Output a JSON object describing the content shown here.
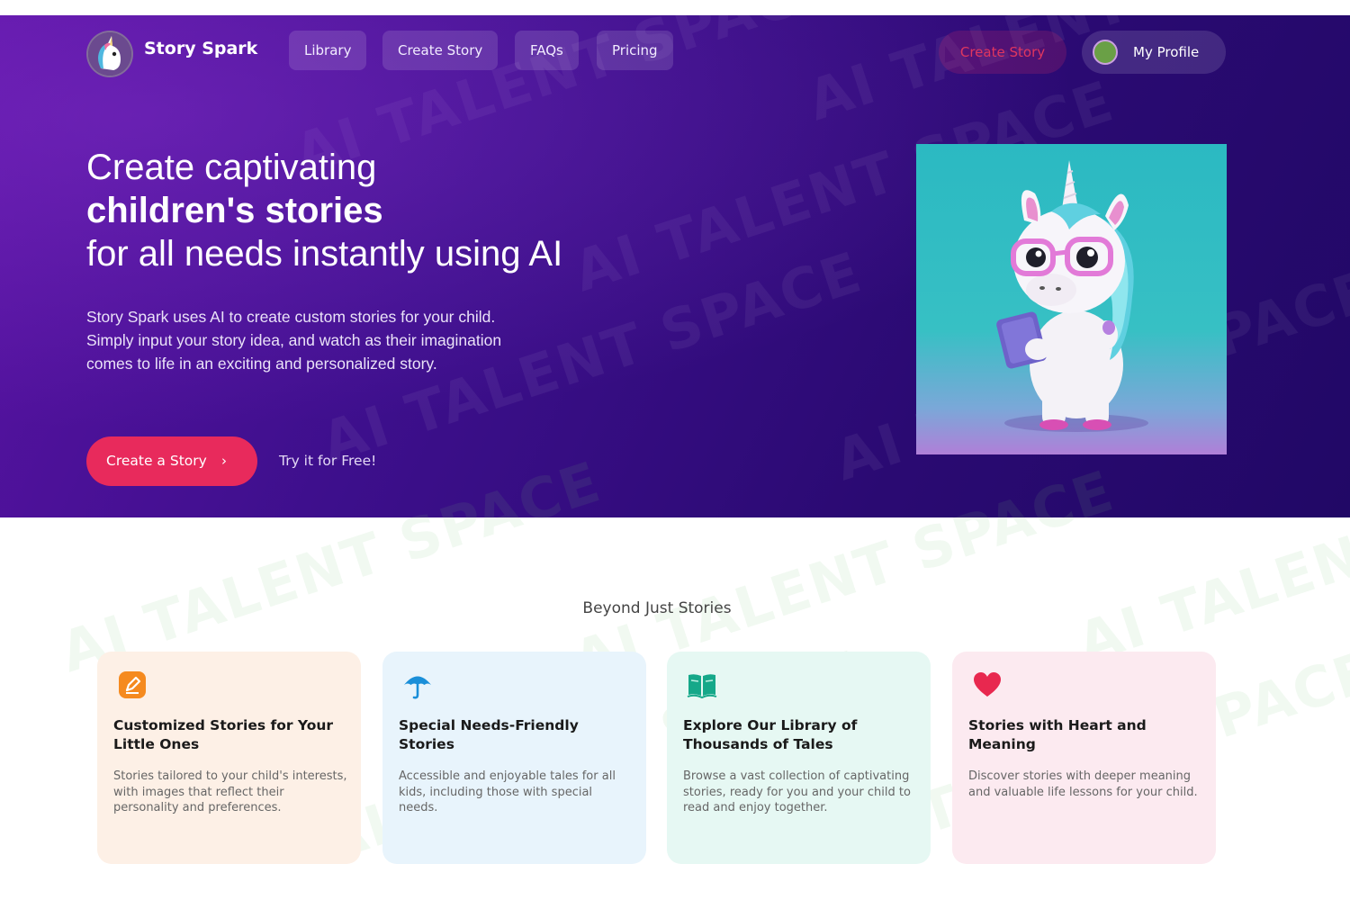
{
  "nav": {
    "brand": "Story Spark",
    "items": [
      {
        "label": "Library"
      },
      {
        "label": "Create Story"
      },
      {
        "label": "FAQs"
      },
      {
        "label": "Pricing"
      }
    ],
    "create_story_pill": "Create Story",
    "profile_label": "My Profile"
  },
  "hero": {
    "headline_line1": "Create captivating",
    "headline_line2": "children's stories",
    "headline_line3": "for all needs instantly using AI",
    "description": [
      "Story Spark uses AI to create custom stories for your child.",
      "Simply input your story idea, and watch as their imagination",
      "comes to life in an exciting and personalized story."
    ],
    "cta_label": "Create a Story",
    "cta_chevron": "›",
    "try_free": "Try it for Free!"
  },
  "watermark": "AI TALENT SPACE",
  "features": {
    "section_title": "Beyond Just Stories",
    "cards": [
      {
        "icon": "edit-icon",
        "title": "Customized Stories for Your Little Ones",
        "body": "Stories tailored to your child's interests, with images that reflect their personality and preferences.",
        "bg": "#fdf0e6",
        "icon_color": "#f58a1f"
      },
      {
        "icon": "umbrella-icon",
        "title": "Special Needs-Friendly Stories",
        "body": "Accessible and enjoyable tales for all kids, including those with special needs.",
        "bg": "#e8f4fc",
        "icon_color": "#1a8fd9"
      },
      {
        "icon": "open-book-icon",
        "title": "Explore Our Library of Thousands of Tales",
        "body": "Browse a vast collection of captivating stories, ready for you and your child to read and enjoy together.",
        "bg": "#e6f8f3",
        "icon_color": "#15a889"
      },
      {
        "icon": "heart-icon",
        "title": "Stories with Heart and Meaning",
        "body": "Discover stories with deeper meaning and valuable life lessons for your child.",
        "bg": "#fceaf0",
        "icon_color": "#e8284f"
      }
    ]
  },
  "colors": {
    "hero_gradient_start": "#5a13a4",
    "hero_gradient_end": "#210866",
    "accent": "#e82a5c"
  }
}
